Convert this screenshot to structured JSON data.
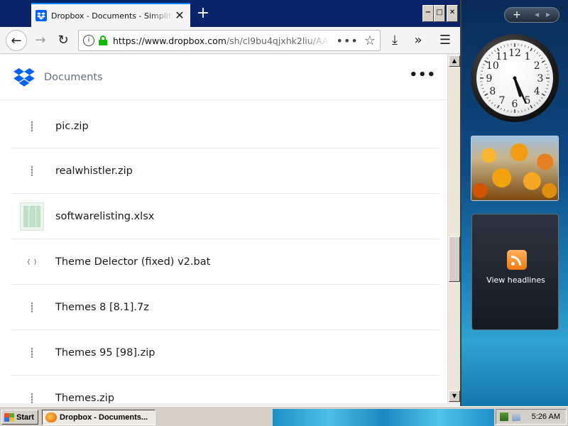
{
  "browser": {
    "tab_title": "Dropbox - Documents - Simplify yo",
    "url_host": "https://www.dropbox.com",
    "url_path": "/sh/cl9bu4qjxhk2liu/AA",
    "url_actions": "•••",
    "icons": {
      "back": "←",
      "forward": "→",
      "reload": "↻",
      "info": "i",
      "star": "☆",
      "download": "⤓",
      "overflow": "»",
      "menu": "☰",
      "close_tab": "✕",
      "new_tab": "+"
    },
    "window_controls": [
      "−",
      "□",
      "✕"
    ]
  },
  "page": {
    "heading": "Documents",
    "more_label": "•••",
    "files": [
      {
        "name": "pic.zip",
        "type": "zip"
      },
      {
        "name": "realwhistler.zip",
        "type": "zip"
      },
      {
        "name": "softwarelisting.xlsx",
        "type": "xlsx"
      },
      {
        "name": "Theme Delector (fixed) v2.bat",
        "type": "bat"
      },
      {
        "name": "Themes 8 [8.1].7z",
        "type": "zip"
      },
      {
        "name": "Themes 95 [98].zip",
        "type": "zip"
      },
      {
        "name": "Themes.zip",
        "type": "zip"
      }
    ]
  },
  "scrollbar": {
    "up": "▲",
    "down": "▼"
  },
  "gadgets": {
    "add_button": "+",
    "nav": [
      "◀",
      "▶"
    ],
    "clock_numbers": [
      "12",
      "1",
      "2",
      "3",
      "4",
      "5",
      "6",
      "7",
      "8",
      "9",
      "10",
      "11"
    ],
    "clock_time": {
      "hour": 5,
      "minute": 26
    },
    "news_label": "View headlines"
  },
  "taskbar": {
    "start_label": "Start",
    "task_label": "Dropbox - Documents...",
    "clock": "5:26 AM"
  },
  "colors": {
    "dropbox_blue": "#0061fe",
    "lock_green": "#12bc00",
    "title_bar": "#0a246a"
  }
}
